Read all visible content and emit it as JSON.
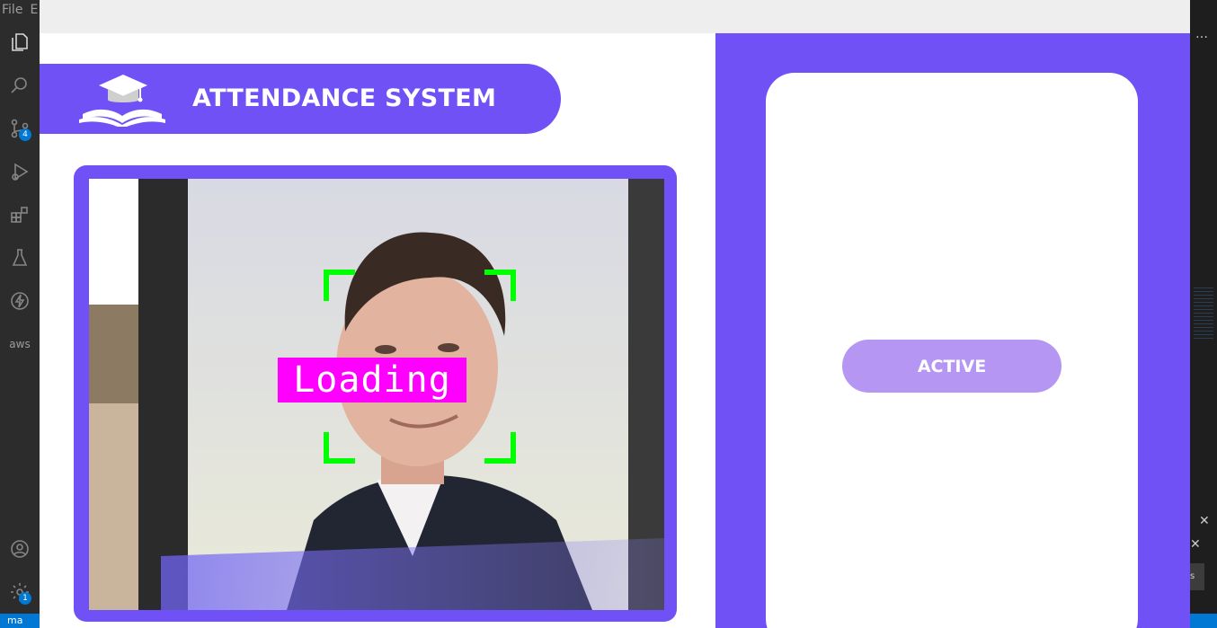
{
  "vscode": {
    "menu": [
      "File",
      "E"
    ],
    "activity_icons": [
      "explorer-icon",
      "search-icon",
      "source-control-icon",
      "run-debug-icon",
      "extensions-icon",
      "testing-icon",
      "lightning-icon",
      "aws-icon",
      "account-icon",
      "settings-icon"
    ],
    "source_control_badge": "4",
    "settings_badge": "1",
    "aws_label": "aws",
    "branch_label": "ma",
    "right_more": "…",
    "close_glyph": "✕",
    "button_s": "s"
  },
  "app": {
    "title": "ATTENDANCE SYSTEM",
    "accent_color": "#7051f5",
    "camera": {
      "overlay_label": "Loading",
      "overlay_color": "#ff00ff",
      "face_box_color": "#00ff00"
    },
    "status_button": {
      "label": "ACTIVE",
      "color": "#b597f3"
    }
  }
}
